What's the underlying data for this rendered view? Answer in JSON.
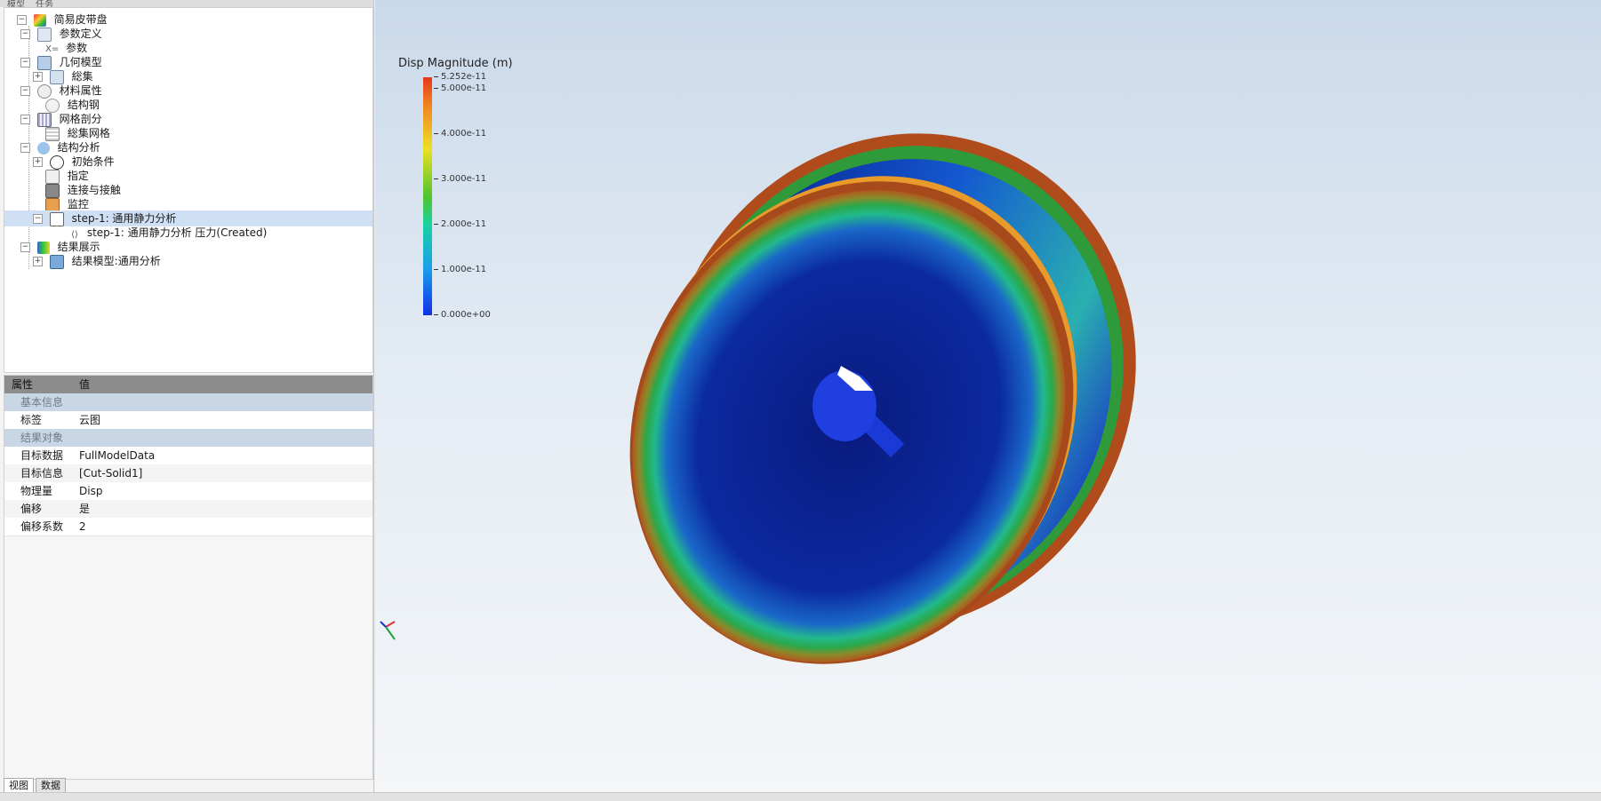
{
  "top_tabs": [
    "模型",
    "任务"
  ],
  "tree": {
    "root": "简易皮带盘",
    "items": [
      {
        "label": "参数定义"
      },
      {
        "label": "参数",
        "prefix": "X="
      },
      {
        "label": "几何模型"
      },
      {
        "label": "総集"
      },
      {
        "label": "材料属性"
      },
      {
        "label": "结构钢"
      },
      {
        "label": "网格剖分"
      },
      {
        "label": "総集网格"
      },
      {
        "label": "结构分析"
      },
      {
        "label": "初始条件"
      },
      {
        "label": "指定"
      },
      {
        "label": "连接与接触"
      },
      {
        "label": "监控"
      },
      {
        "label": "step-1: 通用静力分析"
      },
      {
        "label": "step-1: 通用静力分析 压力(Created)"
      },
      {
        "label": "结果展示"
      },
      {
        "label": "结果模型:通用分析"
      }
    ]
  },
  "properties": {
    "header": {
      "key": "属性",
      "value": "值"
    },
    "group1": "基本信息",
    "rows1": [
      {
        "key": "标签",
        "value": "云图"
      }
    ],
    "group2": "结果对象",
    "rows2": [
      {
        "key": "目标数据",
        "value": "FullModelData"
      },
      {
        "key": "目标信息",
        "value": "[Cut-Solid1]"
      },
      {
        "key": "物理量",
        "value": "Disp"
      },
      {
        "key": "偏移",
        "value": "是"
      },
      {
        "key": "偏移系数",
        "value": "2"
      }
    ]
  },
  "bottom_tabs": [
    "视图",
    "数据"
  ],
  "legend": {
    "title": "Disp Magnitude (m)",
    "ticks": [
      "5.252e-11",
      "5.000e-11",
      "4.000e-11",
      "3.000e-11",
      "2.000e-11",
      "1.000e-11",
      "0.000e+00"
    ],
    "colors": {
      "max": "#e8351c",
      "mid": "#50c52c",
      "min": "#1030e8"
    }
  },
  "icons": [
    "model-root-icon",
    "param-icon",
    "geometry-icon",
    "material-icon",
    "mesh-icon",
    "analysis-icon",
    "step-icon",
    "result-icon",
    "axis-triad-icon"
  ]
}
